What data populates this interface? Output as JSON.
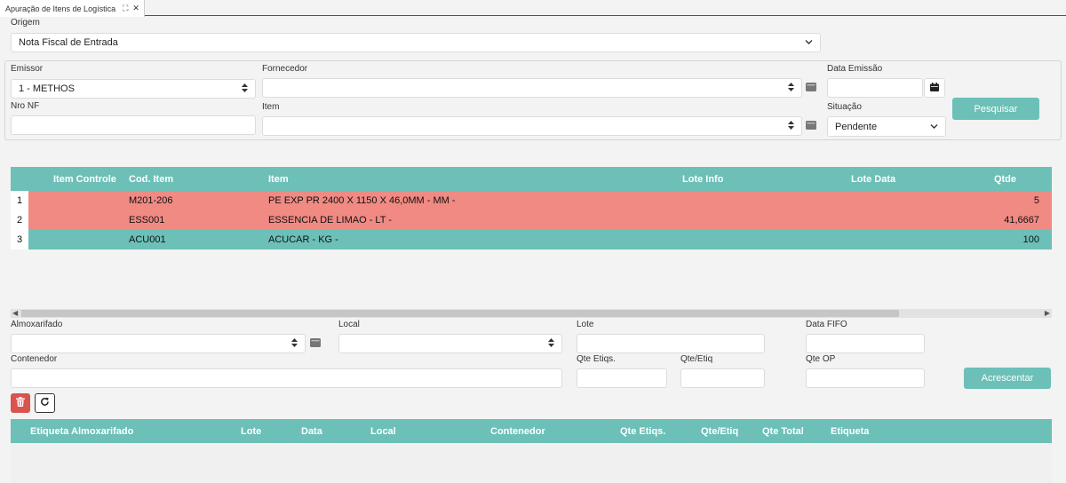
{
  "tab": {
    "title": "Apuração de Itens de Logística"
  },
  "origem": {
    "label": "Origem",
    "value": "Nota Fiscal de Entrada"
  },
  "filters": {
    "emissor": {
      "label": "Emissor",
      "value": "1 - METHOS"
    },
    "fornecedor": {
      "label": "Fornecedor",
      "value": ""
    },
    "data_emissao": {
      "label": "Data Emissão",
      "value": ""
    },
    "nro_nf": {
      "label": "Nro NF",
      "value": ""
    },
    "item": {
      "label": "Item",
      "value": ""
    },
    "situacao": {
      "label": "Situação",
      "value": "Pendente"
    },
    "search_button": "Pesquisar"
  },
  "items_table": {
    "columns": [
      "Item Controle",
      "Cod. Item",
      "Item",
      "Lote Info",
      "Lote Data",
      "Qtde"
    ],
    "rows": [
      {
        "num": "1",
        "controle": "",
        "cod": "M201-206",
        "item": "PE EXP PR 2400 X 1150 X 46,0MM - MM -",
        "lote_info": "",
        "lote_data": "",
        "qtde": "5",
        "color": "#f08a83"
      },
      {
        "num": "2",
        "controle": "",
        "cod": "ESS001",
        "item": "ESSENCIA DE LIMAO - LT -",
        "lote_info": "",
        "lote_data": "",
        "qtde": "41,6667",
        "color": "#f08a83"
      },
      {
        "num": "3",
        "controle": "",
        "cod": "ACU001",
        "item": "ACUCAR - KG -",
        "lote_info": "",
        "lote_data": "",
        "qtde": "100",
        "color": "#6cc0b7"
      }
    ]
  },
  "entry": {
    "almoxarifado": {
      "label": "Almoxarifado",
      "value": ""
    },
    "local": {
      "label": "Local",
      "value": ""
    },
    "lote": {
      "label": "Lote",
      "value": ""
    },
    "data_fifo": {
      "label": "Data FIFO",
      "value": ""
    },
    "contenedor": {
      "label": "Contenedor",
      "value": ""
    },
    "qte_etiqs": {
      "label": "Qte Etiqs.",
      "value": ""
    },
    "qte_etiq": {
      "label": "Qte/Etiq",
      "value": ""
    },
    "qte_op": {
      "label": "Qte OP",
      "value": ""
    },
    "add_button": "Acrescentar"
  },
  "labels_table": {
    "columns": [
      "Etiqueta Almoxarifado",
      "Lote",
      "Data",
      "Local",
      "Contenedor",
      "Qte Etiqs.",
      "Qte/Etiq",
      "Qte Total",
      "Etiqueta"
    ]
  },
  "colors": {
    "accent": "#6cc0b7",
    "alert_row": "#f08a83",
    "delete": "#d9534f",
    "tab_border": "#0a7a3a"
  }
}
